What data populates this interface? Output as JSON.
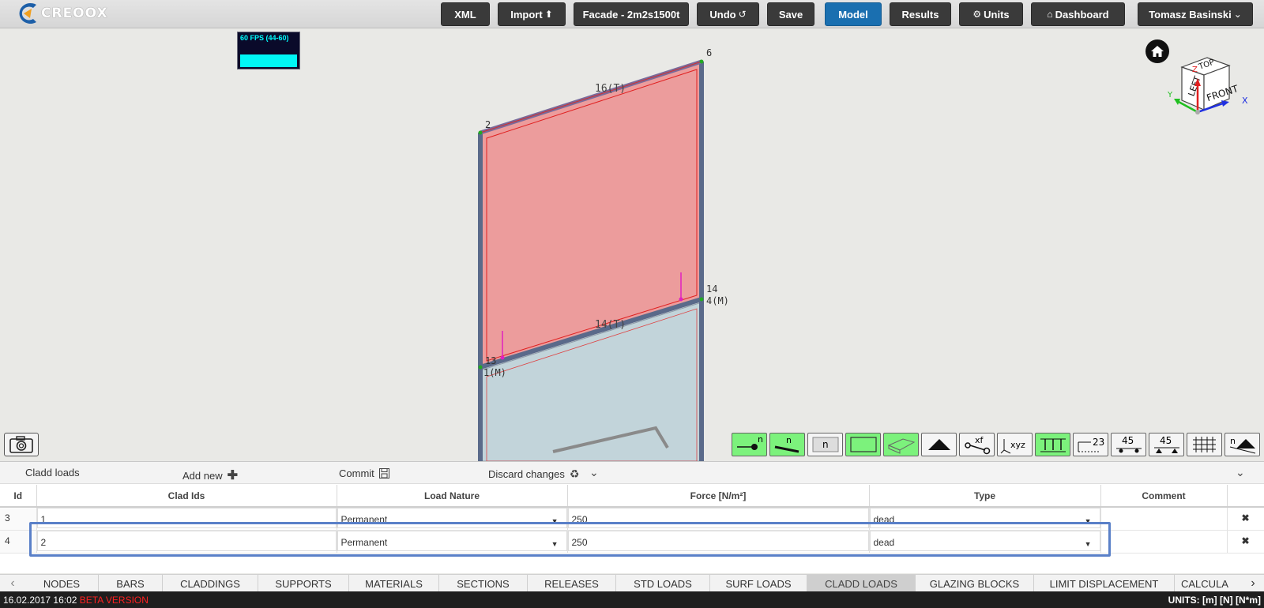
{
  "app": {
    "logo_text": "CREOOX"
  },
  "nav": {
    "xml": "XML",
    "import": "Import",
    "facade": "Facade - 2m2s1500t",
    "undo": "Undo",
    "save": "Save",
    "model": "Model",
    "results": "Results",
    "units": "Units",
    "dashboard": "Dashboard",
    "user": "Tomasz Basinski"
  },
  "viewport": {
    "fps": "60 FPS (44-60)",
    "fps_level": 1.0,
    "labels": {
      "node_2": "2",
      "node_6": "6",
      "node_14": "14",
      "node_14_sub": "4(M)",
      "node_13": "13",
      "node_13_sub": "1(M)",
      "bar_top": "16(T)",
      "bar_mid": "14(T)"
    },
    "cube": {
      "top": "TOP",
      "left": "LEFT",
      "front": "FRONT",
      "x": "X",
      "y": "Y",
      "z": "Z"
    },
    "tools": {
      "n_node": "n",
      "n_bar": "n",
      "n_face": "n",
      "xf": "xf",
      "xyz": "xyz",
      "num23": "23",
      "a45a": "45",
      "a45b": "45",
      "n_sup": "n"
    }
  },
  "panel": {
    "title": "Cladd loads",
    "add_new": "Add new",
    "commit": "Commit",
    "discard": "Discard changes",
    "columns": [
      "Id",
      "Clad Ids",
      "Load Nature",
      "Force [N/m²]",
      "Type",
      "Comment"
    ],
    "rows": [
      {
        "id": "3",
        "clad_ids": "1",
        "nature": "Permanent",
        "force": "250",
        "type": "dead",
        "comment": ""
      },
      {
        "id": "4",
        "clad_ids": "2",
        "nature": "Permanent",
        "force": "250",
        "type": "dead",
        "comment": ""
      }
    ]
  },
  "tabs": [
    "NODES",
    "BARS",
    "CLADDINGS",
    "SUPPORTS",
    "MATERIALS",
    "SECTIONS",
    "RELEASES",
    "STD LOADS",
    "SURF LOADS",
    "CLADD LOADS",
    "GLAZING BLOCKS",
    "LIMIT DISPLACEMENT",
    "CALCULA"
  ],
  "active_tab": "CLADD LOADS",
  "status": {
    "datetime": "16.02.2017 16:02",
    "beta": "BETA VERSION",
    "units": "UNITS: [m] [N] [N*m]"
  },
  "colors": {
    "accent": "#1a6fb0",
    "toggle_on": "#7cf27c",
    "clad_loaded": "#ec9c9c",
    "clad_plain": "#c2d4da"
  }
}
